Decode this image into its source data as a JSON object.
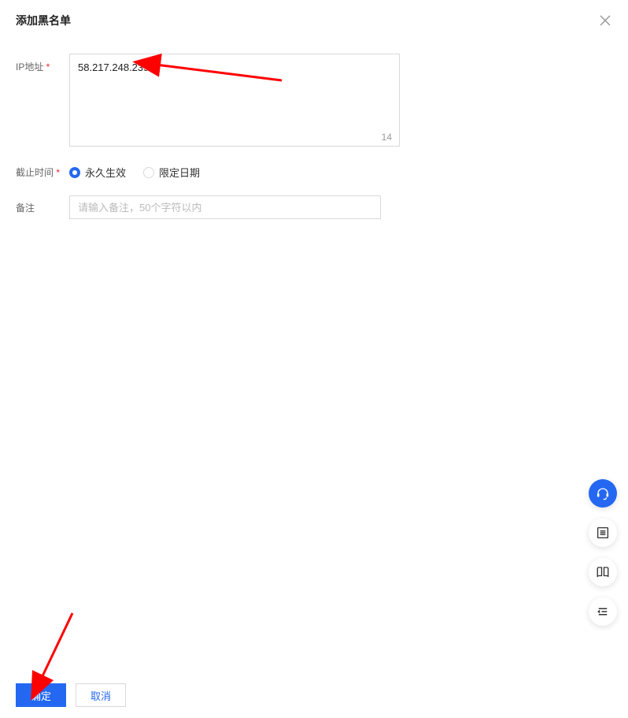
{
  "dialog": {
    "title": "添加黑名单"
  },
  "form": {
    "ip_label": "IP地址",
    "ip_value": "58.217.248.239",
    "ip_char_count": "14",
    "deadline_label": "截止时间",
    "radio_permanent": "永久生效",
    "radio_limited": "限定日期",
    "remark_label": "备注",
    "remark_placeholder": "请输入备注，50个字符以内"
  },
  "footer": {
    "confirm": "确定",
    "cancel": "取消"
  }
}
